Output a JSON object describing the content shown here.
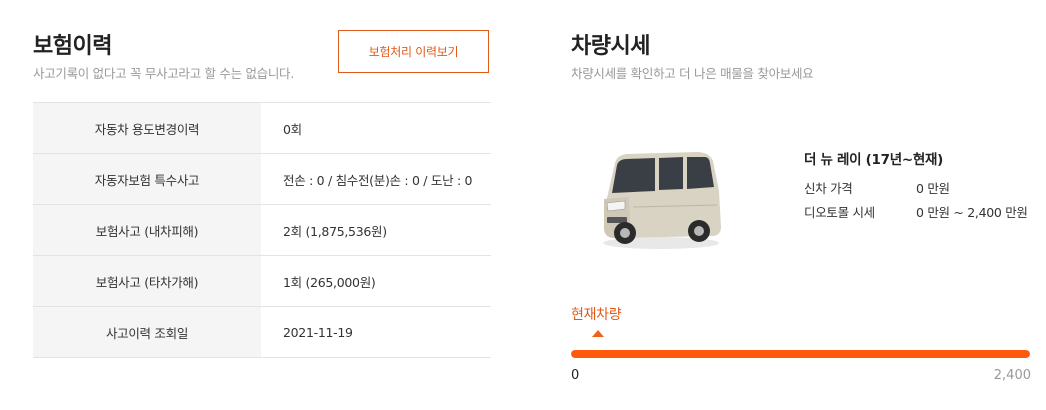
{
  "insurance": {
    "title": "보험이력",
    "subtitle": "사고기록이 없다고 꼭 무사고라고 할 수는 없습니다.",
    "history_button": "보험처리 이력보기",
    "rows": [
      {
        "label": "자동차 용도변경이력",
        "value": "0회"
      },
      {
        "label": "자동자보험 특수사고",
        "value": "전손 : 0 / 침수전(분)손 : 0 / 도난 : 0"
      },
      {
        "label": "보험사고 (내차피해)",
        "value": "2회 (1,875,536원)"
      },
      {
        "label": "보험사고 (타차가해)",
        "value": "1회 (265,000원)"
      },
      {
        "label": "사고이력 조회일",
        "value": "2021-11-19"
      }
    ]
  },
  "market": {
    "title": "차량시세",
    "subtitle": "차량시세를 확인하고 더 나은 매물을 찾아보세요",
    "car_name": "더 뉴 레이 (17년~현재)",
    "new_price_label": "신차 가격",
    "new_price_value": "0 만원",
    "market_label": "디오토몰 시세",
    "market_value": "0 만원 ~ 2,400 만원",
    "current_label": "현재차량",
    "scale_min": "0",
    "scale_max": "2,400",
    "bar_fill_fraction": 1.0,
    "accent_color": "#ff5a0a",
    "car_icon": "car-photo"
  }
}
